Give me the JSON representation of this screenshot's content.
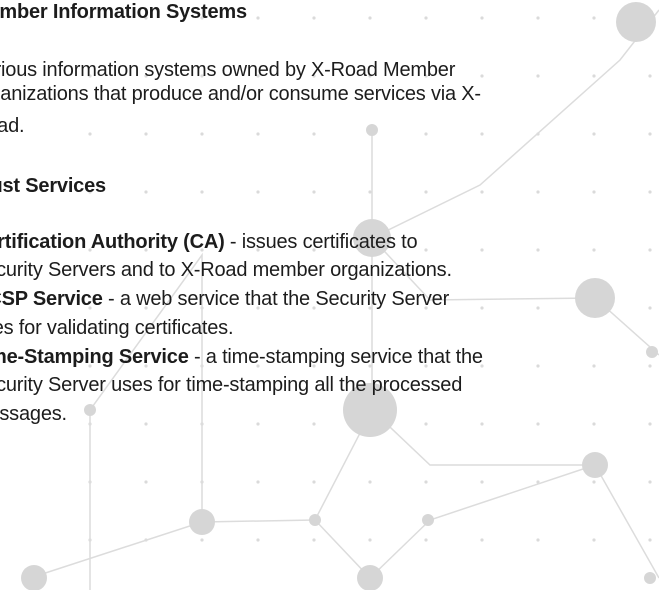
{
  "section1": {
    "heading": "Member Information Systems",
    "body_lines": [
      "Various information systems owned by X-Road Member",
      "organizations that produce and/or consume services via X-",
      "Road."
    ]
  },
  "section2": {
    "heading": "Trust Services",
    "items": [
      {
        "lines": [
          {
            "bold": "Certification Authority (CA)",
            "rest": " - issues certificates to"
          },
          {
            "bold": "",
            "rest": "Security Servers and to X-Road member organizations."
          }
        ]
      },
      {
        "lines": [
          {
            "bold": "OCSP Service",
            "rest": " - a web service that the Security Server"
          },
          {
            "bold": "",
            "rest": "uses for validating certificates."
          }
        ]
      },
      {
        "lines": [
          {
            "bold": "Time-Stamping Service",
            "rest": " - a time-stamping service that the"
          },
          {
            "bold": "",
            "rest": "Security Server uses for time-stamping all the processed"
          },
          {
            "bold": "",
            "rest": "messages."
          }
        ]
      }
    ]
  },
  "background": {
    "accent_color": "#d6d6d6",
    "dot_color": "#dadada"
  }
}
